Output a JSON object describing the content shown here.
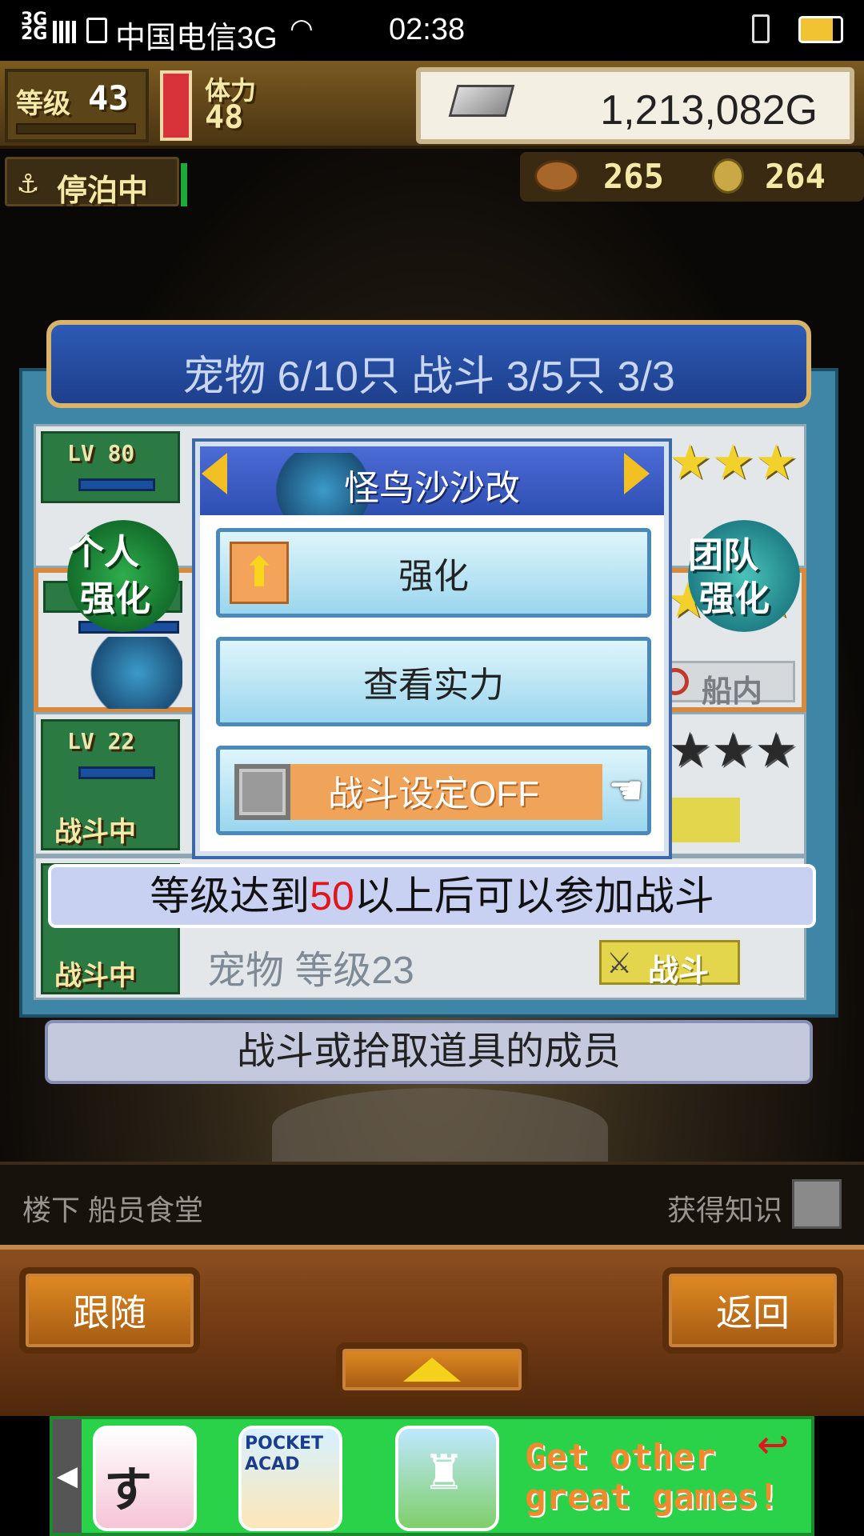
{
  "status_bar": {
    "network_type": "3G 2G",
    "carrier": "中国电信3G",
    "time": "02:38"
  },
  "hud": {
    "level_label": "等级",
    "level_value": "43",
    "stamina_label": "体力",
    "stamina_value": "48",
    "gold": "1,213,082G",
    "docked_label": "停泊中",
    "food_count": "265",
    "coin_count": "264"
  },
  "panel": {
    "header": "宠物 6/10只 战斗 3/5只  3/3",
    "personal_boost": [
      "个人",
      "强化"
    ],
    "team_boost": [
      "团队",
      "强化"
    ],
    "rows": [
      {
        "lv": "LV 80",
        "status": ""
      },
      {
        "lv": "",
        "status": ""
      },
      {
        "lv": "LV 22",
        "status": "战斗中"
      },
      {
        "lv": "",
        "status": "战斗中"
      }
    ],
    "in_ship_label": "船内",
    "battle_tag": "战斗",
    "last_row_text": "宠物 等级23"
  },
  "dialog": {
    "title": "怪鸟沙沙改",
    "strengthen": "强化",
    "view_power": "查看实力",
    "battle_setting": "战斗设定OFF"
  },
  "notice": {
    "prefix": "等级达到",
    "level": "50",
    "suffix": "以上后可以参加战斗"
  },
  "member_bar": "战斗或拾取道具的成员",
  "location": {
    "place": "楼下 船员食堂",
    "knowledge": "获得知识"
  },
  "bottom": {
    "follow": "跟随",
    "back": "返回"
  },
  "ad": {
    "icon1_text": "すし",
    "icon2_text": "POCKET ACAD",
    "line1": "Get other",
    "line2": "great games!"
  },
  "colors": {
    "notice_level": "#e0161c",
    "stars": "#f2d12c",
    "battle_toggle": "#f0a45a"
  }
}
